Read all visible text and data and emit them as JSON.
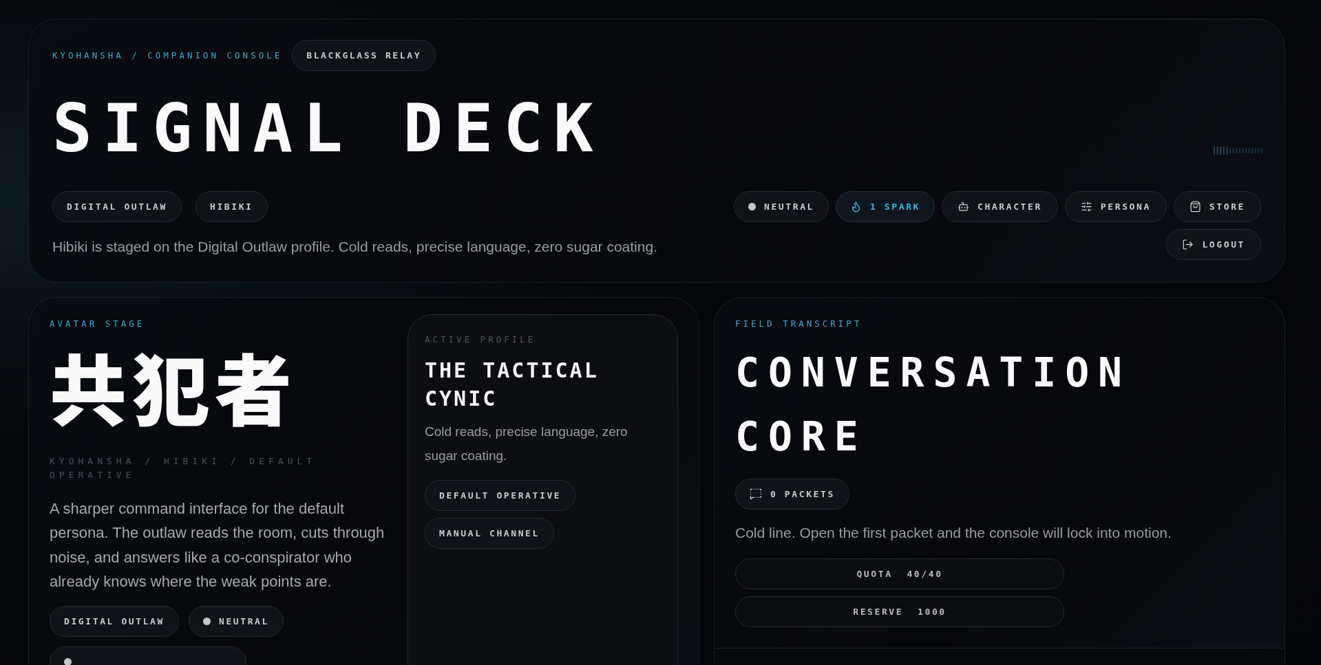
{
  "header": {
    "eyebrow": "KYOHANSHA / COMPANION CONSOLE",
    "relay_badge": "BLACKGLASS RELAY",
    "title": "SIGNAL DECK",
    "tags": [
      "DIGITAL OUTLAW",
      "HIBIKI"
    ],
    "description": "Hibiki is staged on the Digital Outlaw profile. Cold reads, precise language, zero sugar coating.",
    "actions": [
      {
        "kind": "status",
        "label": "NEUTRAL"
      },
      {
        "kind": "spark",
        "label": "1 SPARK"
      },
      {
        "kind": "button",
        "label": "CHARACTER"
      },
      {
        "kind": "button",
        "label": "PERSONA"
      },
      {
        "kind": "button",
        "label": "STORE"
      },
      {
        "kind": "button",
        "label": "LOGOUT"
      }
    ]
  },
  "avatar_stage": {
    "eyebrow": "AVATAR STAGE",
    "glyphs": "共犯者",
    "path": "KYOHANSHA / HIBIKI / DEFAULT OPERATIVE",
    "description": "A sharper command interface for the default persona. The outlaw reads the room, cuts through noise, and answers like a co-conspirator who already knows where the weak points are.",
    "tags": [
      {
        "kind": "plain",
        "label": "DIGITAL OUTLAW"
      },
      {
        "kind": "status",
        "label": "NEUTRAL"
      },
      {
        "kind": "status"
      }
    ],
    "active_profile": {
      "eyebrow": "ACTIVE PROFILE",
      "title": "THE TACTICAL CYNIC",
      "description": "Cold reads, precise language, zero sugar coating.",
      "tags": [
        "DEFAULT OPERATIVE",
        "MANUAL CHANNEL"
      ]
    }
  },
  "field_transcript": {
    "eyebrow": "FIELD TRANSCRIPT",
    "title": "CONVERSATION CORE",
    "packets": "0 PACKETS",
    "description": "Cold line. Open the first packet and the console will lock into motion.",
    "meters": [
      "QUOTA  40/40",
      "RESERVE  1000"
    ]
  }
}
